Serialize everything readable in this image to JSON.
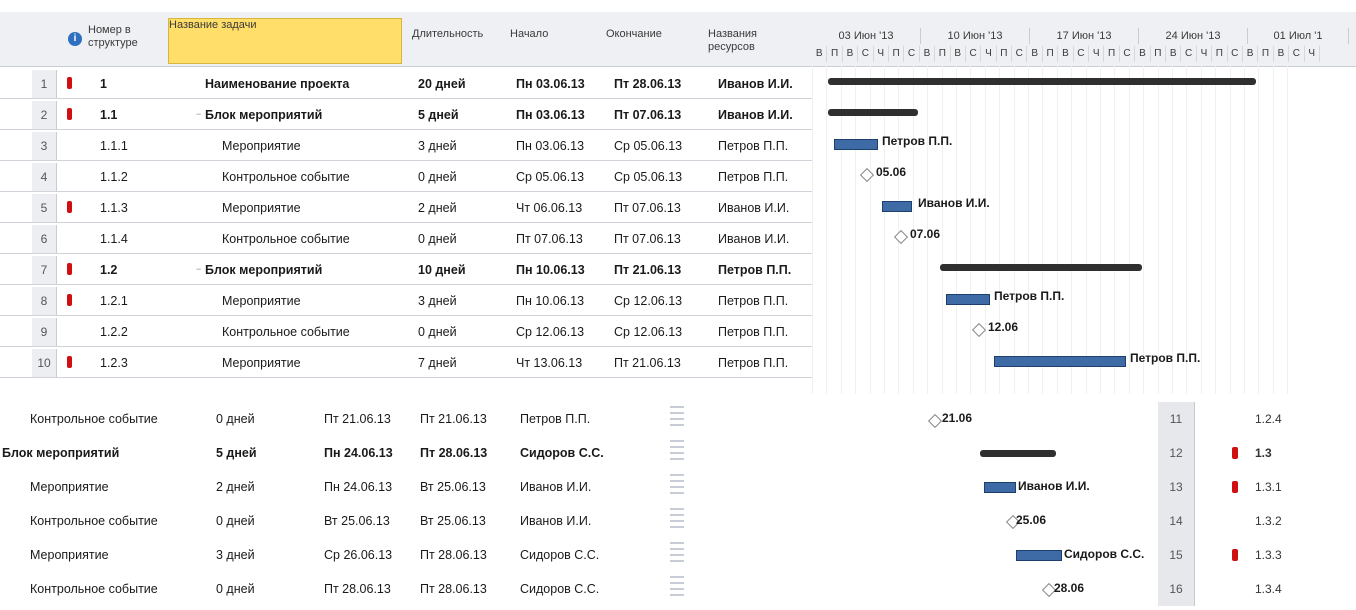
{
  "columns": {
    "wbs": "Номер в структуре",
    "name": "Название задачи",
    "duration": "Длительность",
    "start": "Начало",
    "finish": "Окончание",
    "resources": "Названия ресурсов"
  },
  "timescale": {
    "weeks": [
      "03 Июн '13",
      "10 Июн '13",
      "17 Июн '13",
      "24 Июн '13",
      "01 Июл '1"
    ],
    "day_letters": [
      "В",
      "П",
      "В",
      "С",
      "Ч",
      "П",
      "С",
      "В",
      "П",
      "В",
      "С",
      "Ч",
      "П",
      "С",
      "В",
      "П",
      "В",
      "С",
      "Ч",
      "П",
      "С",
      "В",
      "П",
      "В",
      "С",
      "Ч",
      "П",
      "С",
      "В",
      "П",
      "В",
      "С",
      "Ч"
    ]
  },
  "tasks_upper": [
    {
      "num": "1",
      "wbs": "1",
      "name": "Наименование проекта",
      "duration": "20 дней",
      "start": "Пн 03.06.13",
      "finish": "Пт 28.06.13",
      "resource": "Иванов И.И.",
      "bold": true,
      "indicator": true
    },
    {
      "num": "2",
      "wbs": "1.1",
      "name": "Блок мероприятий",
      "duration": "5 дней",
      "start": "Пн 03.06.13",
      "finish": "Пт 07.06.13",
      "resource": "Иванов И.И.",
      "bold": true,
      "indicator": true
    },
    {
      "num": "3",
      "wbs": "1.1.1",
      "name": "Мероприятие",
      "duration": "3 дней",
      "start": "Пн 03.06.13",
      "finish": "Ср 05.06.13",
      "resource": "Петров П.П.",
      "bold": false,
      "indicator": false
    },
    {
      "num": "4",
      "wbs": "1.1.2",
      "name": "Контрольное событие",
      "duration": "0 дней",
      "start": "Ср 05.06.13",
      "finish": "Ср 05.06.13",
      "resource": "Петров П.П.",
      "bold": false,
      "indicator": false
    },
    {
      "num": "5",
      "wbs": "1.1.3",
      "name": "Мероприятие",
      "duration": "2 дней",
      "start": "Чт 06.06.13",
      "finish": "Пт 07.06.13",
      "resource": "Иванов И.И.",
      "bold": false,
      "indicator": true
    },
    {
      "num": "6",
      "wbs": "1.1.4",
      "name": "Контрольное событие",
      "duration": "0 дней",
      "start": "Пт 07.06.13",
      "finish": "Пт 07.06.13",
      "resource": "Иванов И.И.",
      "bold": false,
      "indicator": false
    },
    {
      "num": "7",
      "wbs": "1.2",
      "name": "Блок мероприятий",
      "duration": "10 дней",
      "start": "Пн 10.06.13",
      "finish": "Пт 21.06.13",
      "resource": "Петров П.П.",
      "bold": true,
      "indicator": true
    },
    {
      "num": "8",
      "wbs": "1.2.1",
      "name": "Мероприятие",
      "duration": "3 дней",
      "start": "Пн 10.06.13",
      "finish": "Ср 12.06.13",
      "resource": "Петров П.П.",
      "bold": false,
      "indicator": true
    },
    {
      "num": "9",
      "wbs": "1.2.2",
      "name": "Контрольное событие",
      "duration": "0 дней",
      "start": "Ср 12.06.13",
      "finish": "Ср 12.06.13",
      "resource": "Петров П.П.",
      "bold": false,
      "indicator": false
    },
    {
      "num": "10",
      "wbs": "1.2.3",
      "name": "Мероприятие",
      "duration": "7 дней",
      "start": "Чт 13.06.13",
      "finish": "Пт 21.06.13",
      "resource": "Петров П.П.",
      "bold": false,
      "indicator": true
    }
  ],
  "gantt_labels": {
    "row3": "Петров П.П.",
    "row4": "05.06",
    "row5": "Иванов И.И.",
    "row6": "07.06",
    "row8": "Петров П.П.",
    "row9": "12.06",
    "row10": "Петров П.П."
  },
  "tasks_lower": [
    {
      "num": "11",
      "wbs": "1.2.4",
      "name": "Контрольное событие",
      "duration": "0 дней",
      "start": "Пт 21.06.13",
      "finish": "Пт 21.06.13",
      "resource": "Петров П.П.",
      "bold": false,
      "indicator": false,
      "gantt_label": "21.06"
    },
    {
      "num": "12",
      "wbs": "1.3",
      "name": "Блок мероприятий",
      "duration": "5 дней",
      "start": "Пн 24.06.13",
      "finish": "Пт 28.06.13",
      "resource": "Сидоров С.С.",
      "bold": true,
      "indicator": true,
      "gantt_label": ""
    },
    {
      "num": "13",
      "wbs": "1.3.1",
      "name": "Мероприятие",
      "duration": "2 дней",
      "start": "Пн 24.06.13",
      "finish": "Вт 25.06.13",
      "resource": "Иванов И.И.",
      "bold": false,
      "indicator": true,
      "gantt_label": "Иванов И.И."
    },
    {
      "num": "14",
      "wbs": "1.3.2",
      "name": "Контрольное событие",
      "duration": "0 дней",
      "start": "Вт 25.06.13",
      "finish": "Вт 25.06.13",
      "resource": "Иванов И.И.",
      "bold": false,
      "indicator": false,
      "gantt_label": "25.06"
    },
    {
      "num": "15",
      "wbs": "1.3.3",
      "name": "Мероприятие",
      "duration": "3 дней",
      "start": "Ср 26.06.13",
      "finish": "Пт 28.06.13",
      "resource": "Сидоров С.С.",
      "bold": false,
      "indicator": true,
      "gantt_label": "Сидоров С.С."
    },
    {
      "num": "16",
      "wbs": "1.3.4",
      "name": "Контрольное событие",
      "duration": "0 дней",
      "start": "Пт 28.06.13",
      "finish": "Пт 28.06.13",
      "resource": "Сидоров С.С.",
      "bold": false,
      "indicator": false,
      "gantt_label": "28.06"
    }
  ],
  "colors": {
    "header_bg": "#eef0f3",
    "selected_header": "#ffde6a",
    "indicator": "#d01010",
    "task_bar": "#3e6aa6",
    "summary_bar": "#2f2f2f"
  },
  "icons": {
    "info": "info-icon"
  }
}
